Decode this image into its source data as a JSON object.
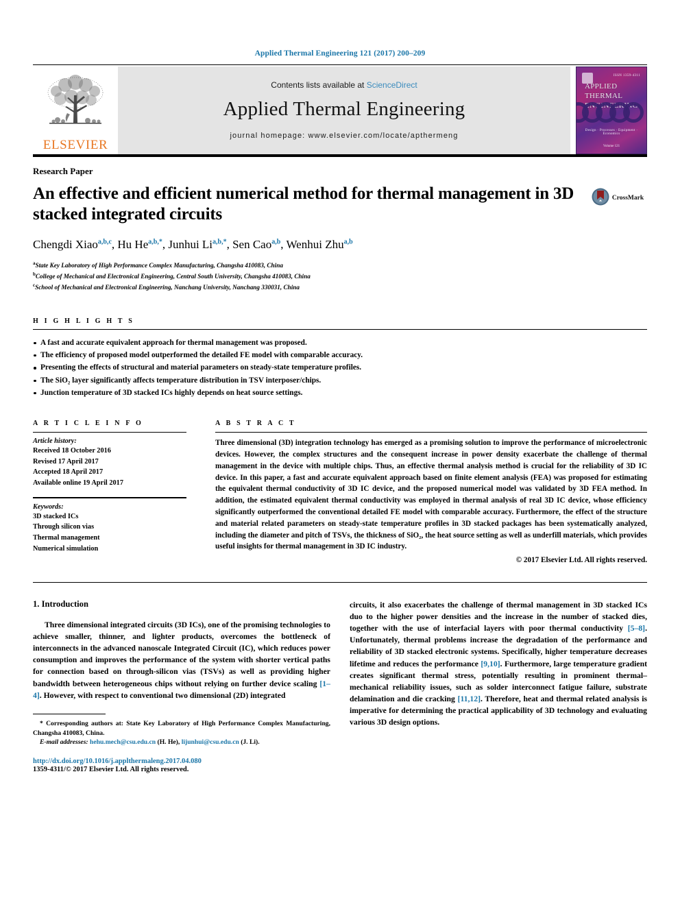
{
  "running_head": "Applied Thermal Engineering 121 (2017) 200–209",
  "masthead": {
    "contents_prefix": "Contents lists available at ",
    "sciencedirect": "ScienceDirect",
    "journal_title": "Applied Thermal Engineering",
    "homepage": "journal homepage: www.elsevier.com/locate/apthermeng",
    "publisher": "ELSEVIER",
    "cover": {
      "line1": "APPLIED",
      "line2": "THERMAL",
      "line3": "ENGINEERING",
      "issue": "ISSN 1359-4311",
      "footer": "Design  ·  Processes  ·  Equipment  ·  Economics",
      "volume": "Volume 121"
    }
  },
  "article": {
    "kind": "Research Paper",
    "title": "An effective and efficient numerical method for thermal management in 3D stacked integrated circuits",
    "crossmark_label": "CrossMark",
    "authors": [
      {
        "name": "Chengdi Xiao",
        "sup": "a,b,c",
        "sep": ", "
      },
      {
        "name": "Hu He",
        "sup": "a,b,*",
        "sep": ", "
      },
      {
        "name": "Junhui Li",
        "sup": "a,b,*",
        "sep": ", "
      },
      {
        "name": "Sen Cao",
        "sup": "a,b",
        "sep": ", "
      },
      {
        "name": "Wenhui Zhu",
        "sup": "a,b",
        "sep": ""
      }
    ],
    "affiliations": [
      {
        "marker": "a",
        "text": "State Key Laboratory of High Performance Complex Manufacturing, Changsha 410083, China"
      },
      {
        "marker": "b",
        "text": "College of Mechanical and Electronical Engineering, Central South University, Changsha 410083, China"
      },
      {
        "marker": "c",
        "text": "School of Mechanical and Electronical Engineering, Nanchang University, Nanchang 330031, China"
      }
    ]
  },
  "highlights": {
    "heading": "H I G H L I G H T S",
    "items": [
      "A fast and accurate equivalent approach for thermal management was proposed.",
      "The efficiency of proposed model outperformed the detailed FE model with comparable accuracy.",
      "Presenting the effects of structural and material parameters on steady-state temperature profiles.",
      "The SiO₂ layer significantly affects temperature distribution in TSV interposer/chips.",
      "Junction temperature of 3D stacked ICs highly depends on heat source settings."
    ]
  },
  "article_info": {
    "heading": "A R T I C L E   I N F O",
    "history_label": "Article history:",
    "history": [
      "Received 18 October 2016",
      "Revised 17 April 2017",
      "Accepted 18 April 2017",
      "Available online 19 April 2017"
    ],
    "keywords_label": "Keywords:",
    "keywords": [
      "3D stacked ICs",
      "Through silicon vias",
      "Thermal management",
      "Numerical simulation"
    ]
  },
  "abstract": {
    "heading": "A B S T R A C T",
    "text": "Three dimensional (3D) integration technology has emerged as a promising solution to improve the performance of microelectronic devices. However, the complex structures and the consequent increase in power density exacerbate the challenge of thermal management in the device with multiple chips. Thus, an effective thermal analysis method is crucial for the reliability of 3D IC device. In this paper, a fast and accurate equivalent approach based on finite element analysis (FEA) was proposed for estimating the equivalent thermal conductivity of 3D IC device, and the proposed numerical model was validated by 3D FEA method. In addition, the estimated equivalent thermal conductivity was employed in thermal analysis of real 3D IC device, whose efficiency significantly outperformed the conventional detailed FE model with comparable accuracy. Furthermore, the effect of the structure and material related parameters on steady-state temperature profiles in 3D stacked packages has been systematically analyzed, including the diameter and pitch of TSVs, the thickness of SiO₂, the heat source setting as well as underfill materials, which provides useful insights for thermal management in 3D IC industry.",
    "copyright": "© 2017 Elsevier Ltd. All rights reserved."
  },
  "body": {
    "section_heading": "1. Introduction",
    "left_paragraph_1": "Three dimensional integrated circuits (3D ICs), one of the promising technologies to achieve smaller, thinner, and lighter products, overcomes the bottleneck of interconnects in the advanced nanoscale Integrated Circuit (IC), which reduces power consumption and improves the performance of the system with shorter vertical paths for connection based on through-silicon vias (TSVs) as well as providing higher bandwidth between heterogeneous chips without relying on further device scaling ",
    "ref_1_4": "[1–4]",
    "left_paragraph_1_tail": ". However, with respect to conventional two dimensional (2D) integrated",
    "right_paragraph_head": "circuits, it also exacerbates the challenge of thermal management in 3D stacked ICs duo to the higher power densities and the increase in the number of stacked dies, together with the use of interfacial layers with poor thermal conductivity ",
    "ref_5_8": "[5–8]",
    "right_paragraph_mid": ". Unfortunately, thermal problems increase the degradation of the performance and reliability of 3D stacked electronic systems. Specifically, higher temperature decreases lifetime and reduces the performance ",
    "ref_9_10": "[9,10]",
    "right_paragraph_mid2": ". Furthermore, large temperature gradient creates significant thermal stress, potentially resulting in prominent thermal–mechanical reliability issues, such as solder interconnect fatigue failure, substrate delamination and die cracking ",
    "ref_11_12": "[11,12]",
    "right_paragraph_tail": ". Therefore, heat and thermal related analysis is imperative for determining the practical applicability of 3D technology and evaluating various 3D design options."
  },
  "footnotes": {
    "corresponding_marker": "*",
    "corresponding": "Corresponding authors at: State Key Laboratory of High Performance Complex Manufacturing, Changsha 410083, China.",
    "email_label": "E-mail addresses:",
    "email_1": "hehu.mech@csu.edu.cn",
    "email_1_who": " (H. He), ",
    "email_2": "lijunhui@csu.edu.cn",
    "email_2_who": " (J. Li).",
    "doi": "http://dx.doi.org/10.1016/j.applthermaleng.2017.04.080",
    "issn": "1359-4311/© 2017 Elsevier Ltd. All rights reserved."
  },
  "colors": {
    "link_blue": "#1b76a8",
    "sciencedirect_blue": "#3a8bbd",
    "elsevier_orange": "#e87722",
    "masthead_gray": "#e4e4e4",
    "crossmark_red": "#8f1d1d"
  }
}
